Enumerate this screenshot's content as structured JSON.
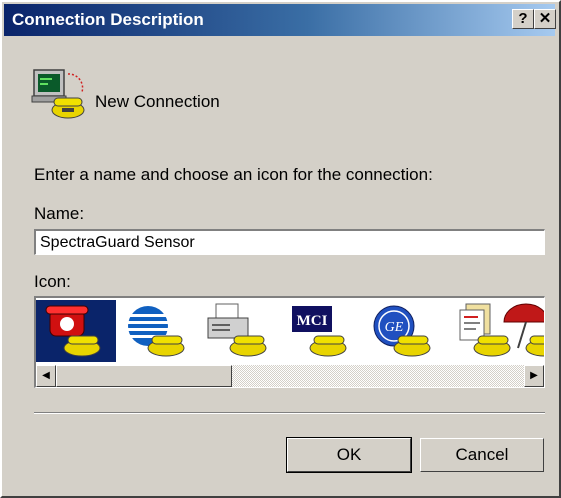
{
  "window": {
    "title": "Connection Description",
    "help_label": "?",
    "close_label": "✕"
  },
  "header": {
    "icon": "new-connection-icon",
    "text": "New Connection"
  },
  "instructions": "Enter a name and choose an icon for the connection:",
  "name_field": {
    "label": "Name:",
    "value": "SpectraGuard Sensor"
  },
  "icon_list": {
    "label": "Icon:",
    "items": [
      {
        "icon": "red-phone-icon",
        "selected": true
      },
      {
        "icon": "att-globe-icon",
        "selected": false
      },
      {
        "icon": "fax-machine-icon",
        "selected": false
      },
      {
        "icon": "mci-logo-icon",
        "selected": false
      },
      {
        "icon": "ge-logo-icon",
        "selected": false
      },
      {
        "icon": "documents-icon",
        "selected": false
      },
      {
        "icon": "umbrella-icon",
        "selected": false
      }
    ],
    "mci_text": "MCI",
    "ge_text": "GE"
  },
  "buttons": {
    "ok": "OK",
    "cancel": "Cancel"
  },
  "colors": {
    "titlebar_start": "#0a246a",
    "titlebar_end": "#a6caf0",
    "dialog_face": "#d4d0c8",
    "selection": "#0a246a"
  }
}
